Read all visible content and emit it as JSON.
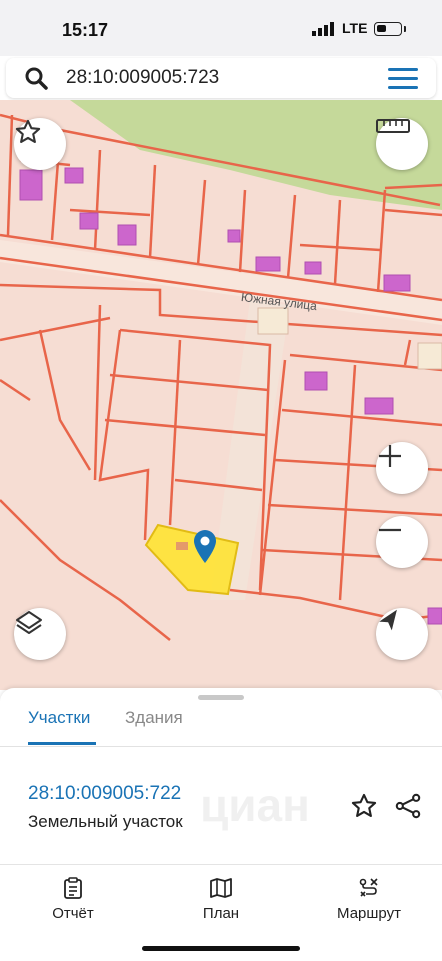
{
  "status": {
    "time": "15:17",
    "network": "LTE"
  },
  "search": {
    "value": "28:10:009005:723"
  },
  "map": {
    "street_label": "Южная улица"
  },
  "sheet": {
    "tabs": [
      {
        "label": "Участки",
        "active": true
      },
      {
        "label": "Здания",
        "active": false
      }
    ],
    "parcel": {
      "number": "28:10:009005:722",
      "type": "Земельный участок"
    },
    "watermark": "циан"
  },
  "nav": [
    {
      "label": "Отчёт",
      "icon": "report-icon"
    },
    {
      "label": "План",
      "icon": "map-icon"
    },
    {
      "label": "Маршрут",
      "icon": "route-icon"
    }
  ],
  "colors": {
    "accent": "#1a73b5",
    "parcel_line": "#e8654a",
    "building": "#cc66cc",
    "selected_parcel": "#ffe433",
    "forest": "#c5d99a"
  }
}
